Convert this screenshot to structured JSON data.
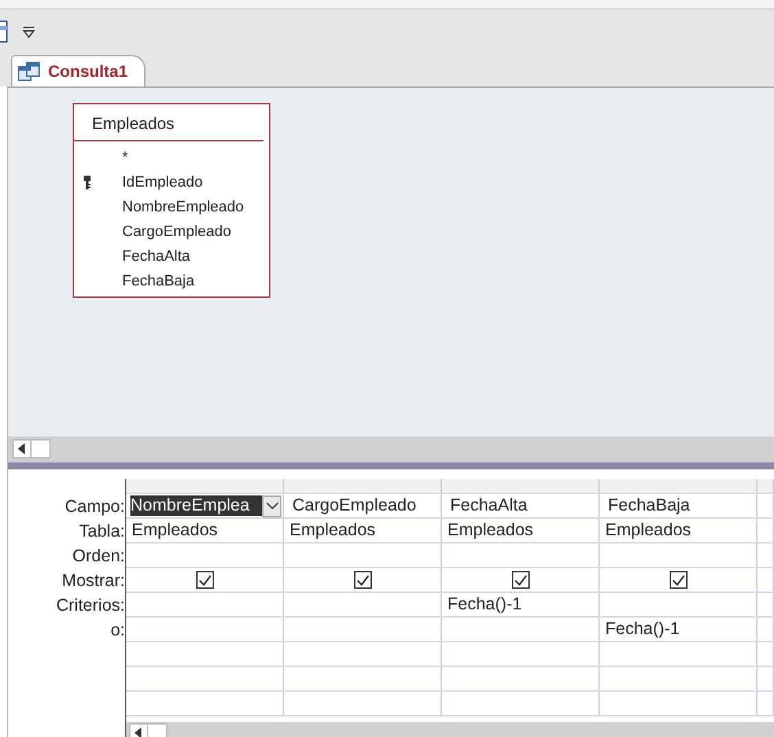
{
  "document_tab": {
    "label": "Consulta1",
    "selected": true
  },
  "table": {
    "title": "Empleados",
    "fields": [
      {
        "name": "*",
        "primary_key": false
      },
      {
        "name": "IdEmpleado",
        "primary_key": true
      },
      {
        "name": "NombreEmpleado",
        "primary_key": false
      },
      {
        "name": "CargoEmpleado",
        "primary_key": false
      },
      {
        "name": "FechaAlta",
        "primary_key": false
      },
      {
        "name": "FechaBaja",
        "primary_key": false
      }
    ]
  },
  "grid": {
    "row_labels": [
      "Campo:",
      "Tabla:",
      "Orden:",
      "Mostrar:",
      "Criterios:",
      "o:"
    ],
    "columns": [
      {
        "field": "NombreEmplea",
        "table": "Empleados",
        "show": true,
        "selected": true
      },
      {
        "field": "CargoEmpleado",
        "table": "Empleados",
        "show": true,
        "selected": false
      },
      {
        "field": "FechaAlta",
        "table": "Empleados",
        "show": true,
        "criteria": "Fecha()-1",
        "selected": false
      },
      {
        "field": "FechaBaja",
        "table": "Empleados",
        "show": true,
        "or": "Fecha()-1",
        "selected": false
      }
    ]
  }
}
